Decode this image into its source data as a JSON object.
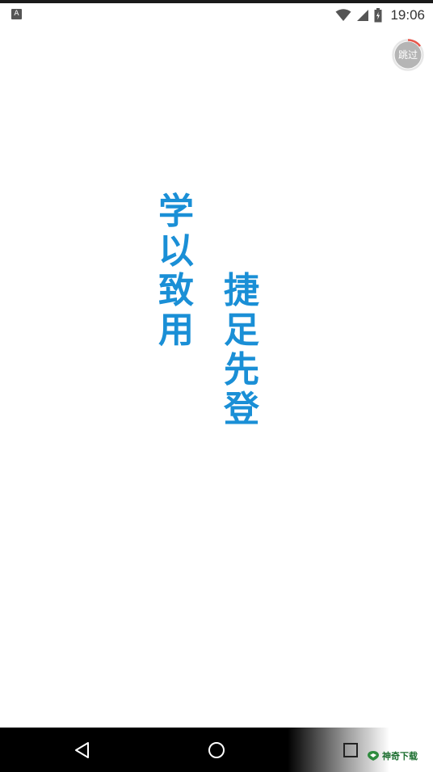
{
  "status_bar": {
    "notification_glyph": "A",
    "time": "19:06",
    "icons": [
      "wifi-icon",
      "signal-icon",
      "battery-icon"
    ]
  },
  "skip_button": {
    "label": "跳过",
    "progress": 0.15,
    "colors": {
      "circle": "#b5b5b5",
      "ring_track": "#e6e6e6",
      "ring_progress": "#e8564b"
    }
  },
  "slogans": {
    "left": "学以致用",
    "right": "捷足先登",
    "color": "#1a8fd6"
  },
  "nav_bar": {
    "buttons": [
      "back-icon",
      "home-icon",
      "recents-icon"
    ]
  },
  "watermark": {
    "text": "神奇下载"
  }
}
